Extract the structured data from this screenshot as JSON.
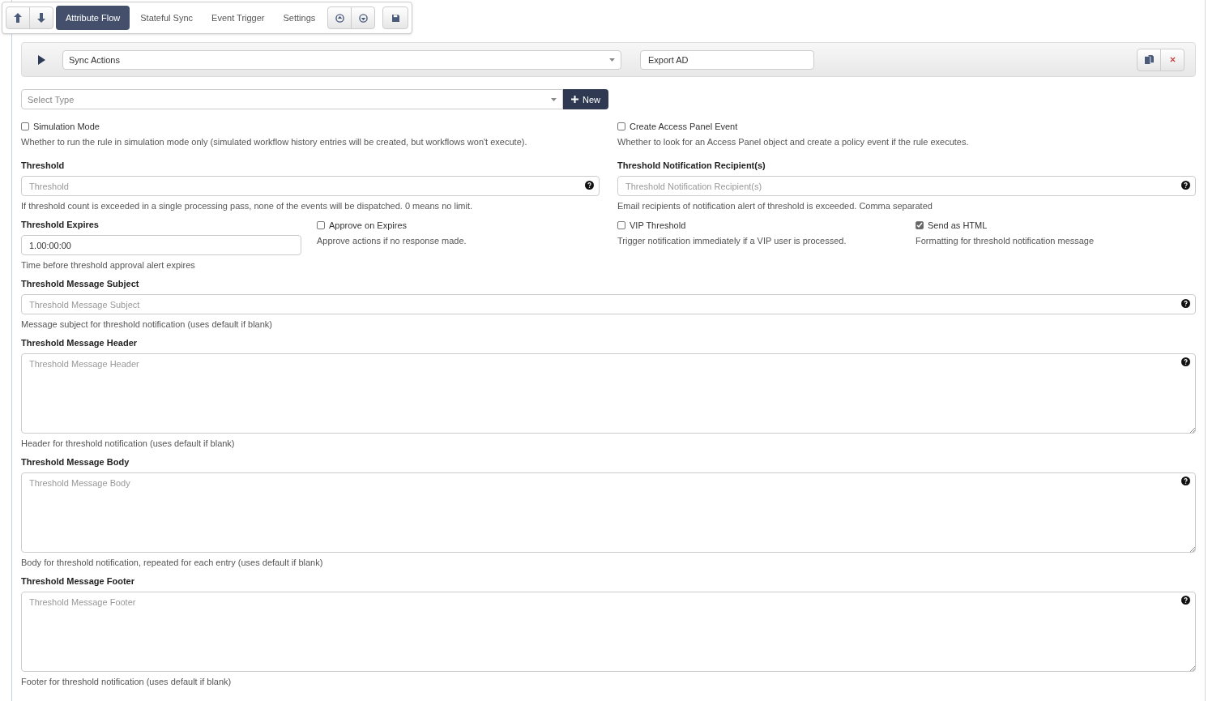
{
  "toolbar": {
    "tabs": [
      {
        "label": "Attribute Flow",
        "selected": true
      },
      {
        "label": "Stateful Sync",
        "selected": false
      },
      {
        "label": "Event Trigger",
        "selected": false
      },
      {
        "label": "Settings",
        "selected": false
      }
    ]
  },
  "action_row": {
    "expanded": false,
    "action_select": "Sync Actions",
    "name": "Export AD"
  },
  "type_select": {
    "placeholder": "Select Type",
    "button": "New"
  },
  "simulation_mode": {
    "label": "Simulation Mode",
    "checked": false,
    "help": "Whether to run the rule in simulation mode only (simulated workflow history entries will be created, but workflows won't execute)."
  },
  "access_panel_event": {
    "label": "Create Access Panel Event",
    "checked": false,
    "help": "Whether to look for an Access Panel object and create a policy event if the rule executes."
  },
  "threshold": {
    "label": "Threshold",
    "placeholder": "Threshold",
    "help": "If threshold count is exceeded in a single processing pass, none of the events will be dispatched. 0 means no limit."
  },
  "recipients": {
    "label": "Threshold Notification Recipient(s)",
    "placeholder": "Threshold Notification Recipient(s)",
    "help": "Email recipients of notification alert of threshold is exceeded. Comma separated"
  },
  "threshold_expires": {
    "label": "Threshold Expires",
    "value": "1.00:00:00",
    "help": "Time before threshold approval alert expires"
  },
  "approve_on_expires": {
    "label": "Approve on Expires",
    "checked": false,
    "help": "Approve actions if no response made."
  },
  "vip_threshold": {
    "label": "VIP Threshold",
    "checked": false,
    "help": "Trigger notification immediately if a VIP user is processed."
  },
  "send_as_html": {
    "label": "Send as HTML",
    "checked": true,
    "help": "Formatting for threshold notification message"
  },
  "message_fields": [
    {
      "kind": "input",
      "label": "Threshold Message Subject",
      "placeholder": "Threshold Message Subject",
      "help": "Message subject for threshold notification (uses default if blank)"
    },
    {
      "kind": "textarea",
      "label": "Threshold Message Header",
      "placeholder": "Threshold Message Header",
      "help": "Header for threshold notification (uses default if blank)"
    },
    {
      "kind": "textarea",
      "label": "Threshold Message Body",
      "placeholder": "Threshold Message Body",
      "help": "Body for threshold notification, repeated for each entry (uses default if blank)"
    },
    {
      "kind": "textarea",
      "label": "Threshold Message Footer",
      "placeholder": "Threshold Message Footer",
      "help": "Footer for threshold notification (uses default if blank)"
    }
  ]
}
